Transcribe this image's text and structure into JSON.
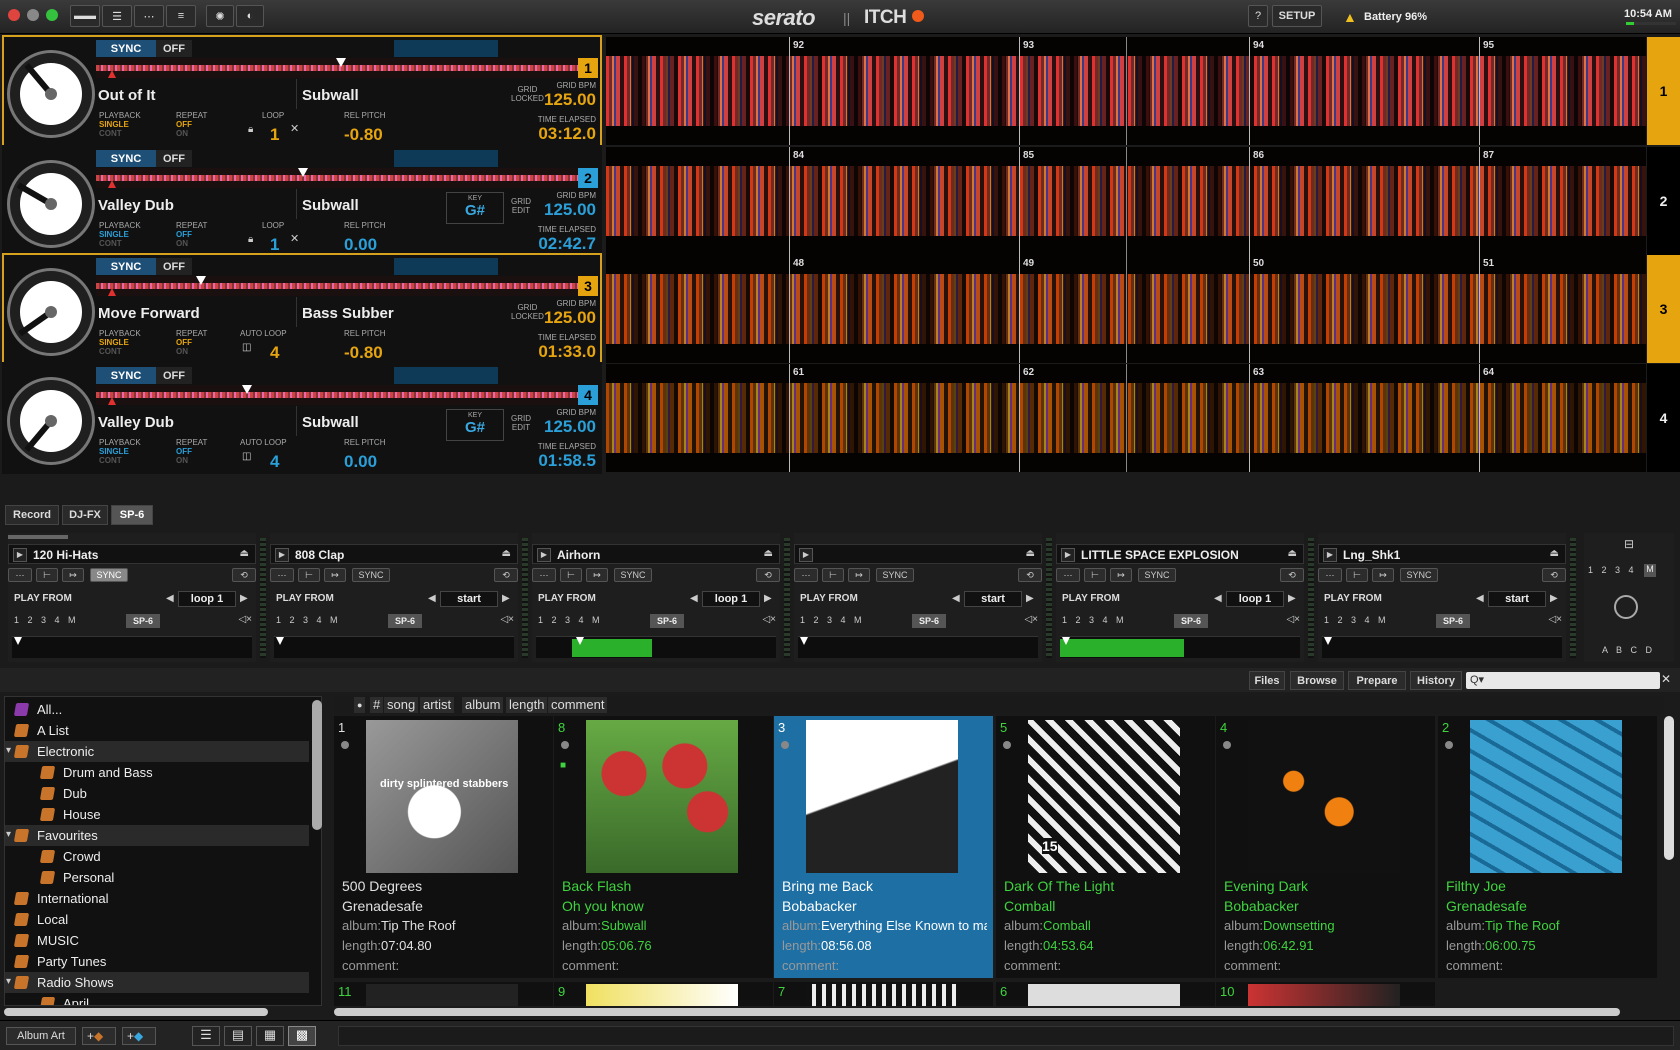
{
  "topbar": {
    "brand_serato": "serato",
    "brand_itch": "ITCH",
    "help_label": "?",
    "setup_label": "SETUP",
    "battery_label": "Battery 96%",
    "clock": "10:54 AM"
  },
  "decks": [
    {
      "id": "1",
      "sync": "SYNC",
      "off": "OFF",
      "title": "Out of It",
      "artist": "Subwall",
      "grid": "GRID\nLOCKED",
      "key_label": "",
      "key": "",
      "bpm_label": "GRID BPM",
      "bpm": "125.00",
      "playback_label": "PLAYBACK",
      "playback": "SINGLE",
      "cont": "CONT",
      "repeat_label": "REPEAT",
      "repeat": "OFF",
      "on": "ON",
      "loop_label": "LOOP",
      "loop": "1",
      "loop_x": "✕",
      "pitch_label": "REL PITCH",
      "pitch": "-0.80",
      "time_label": "TIME ELAPSED",
      "time": "03:12.0",
      "color": "#e6a50f",
      "active": true
    },
    {
      "id": "2",
      "sync": "SYNC",
      "off": "OFF",
      "title": "Valley Dub",
      "artist": "Subwall",
      "grid": "GRID\nEDIT",
      "key_label": "KEY",
      "key": "G#",
      "bpm_label": "GRID BPM",
      "bpm": "125.00",
      "playback_label": "PLAYBACK",
      "playback": "SINGLE",
      "cont": "CONT",
      "repeat_label": "REPEAT",
      "repeat": "OFF",
      "on": "ON",
      "loop_label": "LOOP",
      "loop": "1",
      "loop_x": "✕",
      "pitch_label": "REL PITCH",
      "pitch": "0.00",
      "time_label": "TIME ELAPSED",
      "time": "02:42.7",
      "color": "#2a9fd8",
      "active": false
    },
    {
      "id": "3",
      "sync": "SYNC",
      "off": "OFF",
      "title": "Move Forward",
      "artist": "Bass Subber",
      "grid": "GRID\nLOCKED",
      "key_label": "",
      "key": "",
      "bpm_label": "GRID BPM",
      "bpm": "125.00",
      "playback_label": "PLAYBACK",
      "playback": "SINGLE",
      "cont": "CONT",
      "repeat_label": "REPEAT",
      "repeat": "OFF",
      "on": "ON",
      "loop_label": "AUTO LOOP",
      "loop": "4",
      "loop_x": "",
      "pitch_label": "REL PITCH",
      "pitch": "-0.80",
      "time_label": "TIME ELAPSED",
      "time": "01:33.0",
      "color": "#e6a50f",
      "active": true
    },
    {
      "id": "4",
      "sync": "SYNC",
      "off": "OFF",
      "title": "Valley Dub",
      "artist": "Subwall",
      "grid": "GRID\nEDIT",
      "key_label": "KEY",
      "key": "G#",
      "bpm_label": "GRID BPM",
      "bpm": "125.00",
      "playback_label": "PLAYBACK",
      "playback": "SINGLE",
      "cont": "CONT",
      "repeat_label": "REPEAT",
      "repeat": "OFF",
      "on": "ON",
      "loop_label": "AUTO LOOP",
      "loop": "4",
      "loop_x": "",
      "pitch_label": "REL PITCH",
      "pitch": "0.00",
      "time_label": "TIME ELAPSED",
      "time": "01:58.5",
      "color": "#2a9fd8",
      "active": false
    }
  ],
  "waveforms": [
    {
      "deck": "1",
      "bars": [
        "92",
        "93",
        "94",
        "95"
      ],
      "side_color": "#e6a50f"
    },
    {
      "deck": "2",
      "bars": [
        "84",
        "85",
        "86",
        "87"
      ],
      "side_color": "#000000"
    },
    {
      "deck": "3",
      "bars": [
        "48",
        "49",
        "50",
        "51"
      ],
      "side_color": "#e6a50f"
    },
    {
      "deck": "4",
      "bars": [
        "61",
        "62",
        "63",
        "64"
      ],
      "side_color": "#000000"
    }
  ],
  "fx_tabs": [
    "Record",
    "DJ-FX",
    "SP-6"
  ],
  "sampler": {
    "sync_label": "SYNC",
    "play_from_label": "PLAY FROM",
    "nums": "1 2 3 4 M",
    "sp_label": "SP-6",
    "slots": [
      {
        "name": "120 Hi-Hats",
        "play_from": "loop 1",
        "sync_on": true
      },
      {
        "name": "808 Clap",
        "play_from": "start",
        "sync_on": false
      },
      {
        "name": "Airhorn",
        "play_from": "loop 1",
        "sync_on": false
      },
      {
        "name": "",
        "play_from": "start",
        "sync_on": false
      },
      {
        "name": "LITTLE SPACE EXPLOSION",
        "play_from": "loop 1",
        "sync_on": false
      },
      {
        "name": "Lng_Shk1",
        "play_from": "start",
        "sync_on": false
      }
    ],
    "bank_nums": "1 2 3 4",
    "bank_m": "M",
    "banks": "A B C D"
  },
  "browser": {
    "buttons": [
      "Files",
      "Browse",
      "Prepare",
      "History"
    ],
    "search_placeholder": "Q▾",
    "columns": [
      "●",
      "#",
      "song",
      "artist",
      "album",
      "length",
      "comment"
    ],
    "album_label": "album:",
    "length_label": "length:",
    "comment_label": "comment:",
    "crates": [
      {
        "name": "All...",
        "indent": 0,
        "expand": ""
      },
      {
        "name": "A List",
        "indent": 0,
        "expand": ""
      },
      {
        "name": "Electronic",
        "indent": 0,
        "expand": "▾"
      },
      {
        "name": "Drum and Bass",
        "indent": 1,
        "expand": ""
      },
      {
        "name": "Dub",
        "indent": 1,
        "expand": ""
      },
      {
        "name": "House",
        "indent": 1,
        "expand": ""
      },
      {
        "name": "Favourites",
        "indent": 0,
        "expand": "▾"
      },
      {
        "name": "Crowd",
        "indent": 1,
        "expand": ""
      },
      {
        "name": "Personal",
        "indent": 1,
        "expand": ""
      },
      {
        "name": "International",
        "indent": 0,
        "expand": ""
      },
      {
        "name": "Local",
        "indent": 0,
        "expand": ""
      },
      {
        "name": "MUSIC",
        "indent": 0,
        "expand": ""
      },
      {
        "name": "Party Tunes",
        "indent": 0,
        "expand": ""
      },
      {
        "name": "Radio Shows",
        "indent": 0,
        "expand": "▾"
      },
      {
        "name": "April",
        "indent": 1,
        "expand": ""
      }
    ],
    "tracks": [
      {
        "num": "1",
        "song": "500 Degrees",
        "artist": "Grenadesafe",
        "album": "Tip The Roof",
        "length": "07:04.80",
        "color": "#e0e0e0",
        "selected": false,
        "art_text": "dirty splintered stabbers"
      },
      {
        "num": "8",
        "song": "Back Flash",
        "artist": "Oh you know",
        "album": "Subwall",
        "length": "05:06.76",
        "color": "#3fd43f",
        "selected": false,
        "art_text": ""
      },
      {
        "num": "3",
        "song": "Bring me Back",
        "artist": "Bobabacker",
        "album": "Everything Else Known to ma",
        "length": "08:56.08",
        "color": "#ffffff",
        "selected": true,
        "art_text": ""
      },
      {
        "num": "5",
        "song": "Dark Of The Light",
        "artist": "Comball",
        "album": "Comball",
        "length": "04:53.64",
        "color": "#3fd43f",
        "selected": false,
        "art_text": "15"
      },
      {
        "num": "4",
        "song": "Evening Dark",
        "artist": "Bobabacker",
        "album": "Downsetting",
        "length": "06:42.91",
        "color": "#3fd43f",
        "selected": false,
        "art_text": ""
      },
      {
        "num": "2",
        "song": "Filthy Joe",
        "artist": "Grenadesafe",
        "album": "Tip The Roof",
        "length": "06:00.75",
        "color": "#3fd43f",
        "selected": false,
        "art_text": ""
      }
    ],
    "next_row_nums": [
      "11",
      "9",
      "7",
      "6",
      "10"
    ]
  },
  "bottombar": {
    "album_art_label": "Album Art",
    "add_crate": "+",
    "add_smart": "+"
  }
}
